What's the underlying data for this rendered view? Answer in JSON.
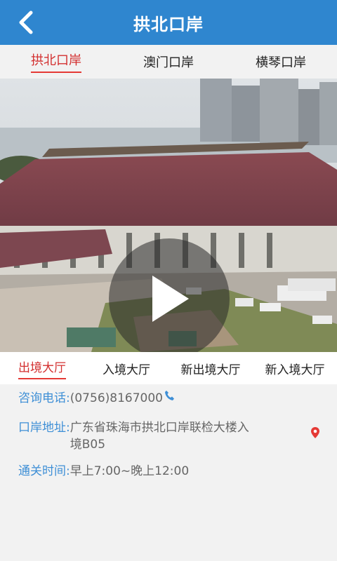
{
  "header": {
    "title": "拱北口岸"
  },
  "ports": [
    {
      "label": "拱北口岸",
      "active": true
    },
    {
      "label": "澳门口岸",
      "active": false
    },
    {
      "label": "横琴口岸",
      "active": false
    }
  ],
  "halls": [
    {
      "label": "出境大厅",
      "active": true
    },
    {
      "label": "入境大厅",
      "active": false
    },
    {
      "label": "新出境大厅",
      "active": false
    },
    {
      "label": "新入境大厅",
      "active": false
    }
  ],
  "info": {
    "phone_label": "咨询电话:",
    "phone_value": "(0756)8167000",
    "address_label": "口岸地址:",
    "address_value_line1": "广东省珠海市拱北口岸联检大楼入",
    "address_value_line2": "境B05",
    "hours_label": "通关时间:",
    "hours_value": "早上7:00~晚上12:00"
  },
  "colors": {
    "header": "#2f86cf",
    "accent_red": "#d32f2f",
    "label_blue": "#3e8fd6"
  }
}
